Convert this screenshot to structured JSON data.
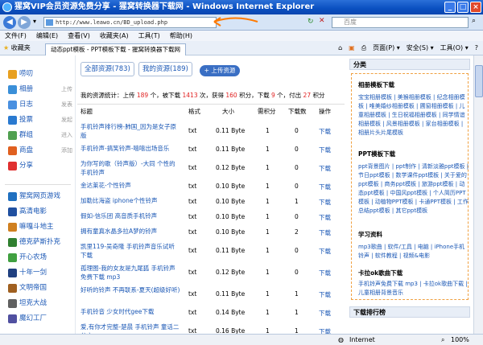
{
  "window": {
    "title": "猩窝VIP会员资源免费分享 - 猩窝转换器下载网 - Windows Internet Explorer",
    "brand_color": "#0a4fc0"
  },
  "address": {
    "url": "http://www.leawo.cn/BD_upload.php"
  },
  "search": {
    "placeholder": "百度"
  },
  "menu": [
    "文件(F)",
    "编辑(E)",
    "查看(V)",
    "收藏夹(A)",
    "工具(T)",
    "帮助(H)"
  ],
  "favbar": {
    "favorites": "收藏夹",
    "tabs": [
      "动态ppt模板 - PPT模板下载 - 猩窝转换器下载网"
    ],
    "tools": [
      "页面(P) ▾",
      "安全(S) ▾",
      "工具(O) ▾",
      "?"
    ]
  },
  "sidebar": {
    "items": [
      {
        "label": "唠叨",
        "sub": "",
        "icon": "chat-icon",
        "color": "#e8a020"
      },
      {
        "label": "相册",
        "sub": "上传",
        "icon": "photo-icon",
        "color": "#3a8fd8"
      },
      {
        "label": "日志",
        "sub": "发表",
        "icon": "log-icon",
        "color": "#4a90e0"
      },
      {
        "label": "投票",
        "sub": "发起",
        "icon": "vote-icon",
        "color": "#2a7ad0"
      },
      {
        "label": "群组",
        "sub": "进入",
        "icon": "group-icon",
        "color": "#50a050"
      },
      {
        "label": "商盘",
        "sub": "添加",
        "icon": "disk-icon",
        "color": "#e06020"
      },
      {
        "label": "分享",
        "sub": "",
        "icon": "heart-icon",
        "color": "#e03030"
      }
    ],
    "apps": [
      {
        "label": "猩窝网页游戏",
        "icon": "game-icon",
        "color": "#2070c0"
      },
      {
        "label": "高清电影",
        "icon": "film-icon",
        "color": "#2050a0"
      },
      {
        "label": "嘛嘎斗地主",
        "icon": "cards-icon",
        "color": "#d08020"
      },
      {
        "label": "德克萨斯扑克",
        "icon": "poker-icon",
        "color": "#308030"
      },
      {
        "label": "开心农场",
        "icon": "farm-icon",
        "color": "#40a040"
      },
      {
        "label": "十年一剑",
        "icon": "sword-icon",
        "color": "#204080"
      },
      {
        "label": "文明帝国",
        "icon": "empire-icon",
        "color": "#a06020"
      },
      {
        "label": "坦克大战",
        "icon": "tank-icon",
        "color": "#606060"
      },
      {
        "label": "魔幻工厂",
        "icon": "factory-icon",
        "color": "#5050a0"
      }
    ]
  },
  "main": {
    "tabs": [
      "全部资源(783)",
      "我的资源(189)"
    ],
    "upload": "+ 上传资源",
    "stats": {
      "prefix": "我的资源统计：上传",
      "upload": "189",
      "u_unit": "个，被下载",
      "downloaded": "1413",
      "d_unit": "次，获得",
      "points": "160",
      "p_unit": "积分，下载",
      "dl": "9",
      "dl_unit": "个，付出",
      "paid": "27",
      "suffix": "积分"
    },
    "headers": [
      "标题",
      "格式",
      "大小",
      "需积分",
      "下载数",
      "操作"
    ],
    "rows": [
      {
        "title": "手机铃声排行榜-肺国_因为是女子原版",
        "fmt": "txt",
        "size": "0.11 Byte",
        "pts": "1",
        "downloads": "0",
        "op": "下载"
      },
      {
        "title": "手机铃声-搞笑铃声-嘻嘻出场音乐",
        "fmt": "txt",
        "size": "0.11 Byte",
        "pts": "1",
        "downloads": "0",
        "op": "下载"
      },
      {
        "title": "为你写的歌（铃声版）-大同 个性的手机铃声",
        "fmt": "txt",
        "size": "0.12 Byte",
        "pts": "1",
        "downloads": "0",
        "op": "下载"
      },
      {
        "title": "金达莱花-个性铃声",
        "fmt": "txt",
        "size": "0.10 Byte",
        "pts": "1",
        "downloads": "0",
        "op": "下载"
      },
      {
        "title": "加勒比海盗 iphone个性铃声",
        "fmt": "txt",
        "size": "0.10 Byte",
        "pts": "1",
        "downloads": "1",
        "op": "下载"
      },
      {
        "title": "假如-信乐团 高音质手机铃声",
        "fmt": "txt",
        "size": "0.10 Byte",
        "pts": "1",
        "downloads": "0",
        "op": "下载"
      },
      {
        "title": "拥有童真水晶多拉A梦的铃声",
        "fmt": "txt",
        "size": "0.10 Byte",
        "pts": "1",
        "downloads": "2",
        "op": "下载"
      },
      {
        "title": "凯里119-吴奇隆 手机铃声音乐试听下载",
        "fmt": "txt",
        "size": "0.11 Byte",
        "pts": "1",
        "downloads": "0",
        "op": "下载"
      },
      {
        "title": "孤理图-我的女友是九尾狐 手机铃声免费下载 mp3",
        "fmt": "txt",
        "size": "0.12 Byte",
        "pts": "1",
        "downloads": "0",
        "op": "下载"
      },
      {
        "title": "好听的铃声 不再联系-夏天(超级好听)",
        "fmt": "txt",
        "size": "0.11 Byte",
        "pts": "1",
        "downloads": "1",
        "op": "下载"
      },
      {
        "title": "手机铃音 少女时代gee下载",
        "fmt": "txt",
        "size": "0.14 Byte",
        "pts": "1",
        "downloads": "1",
        "op": "下载"
      },
      {
        "title": "爱,有你才完整-楚晨 手机铃声 童话二分之一",
        "fmt": "txt",
        "size": "0.16 Byte",
        "pts": "1",
        "downloads": "1",
        "op": "下载"
      }
    ]
  },
  "right": {
    "header": "分类",
    "sections": [
      {
        "title": "相册模板下载",
        "text": "宝宝相册模板 | 美猴相册模板 | 纪念相册模板 | 唯美婚纱相册模板 | 圃窗相册模板 | 儿童相册模板 | 生日祝福相册模板 | 同学情谊相册模板 | 风景相册模板 | 家台相册模板 | 相册片头片尾模板"
      },
      {
        "title": "PPT模板下载",
        "text": "ppt背景图片 | ppt制作 | 清新淡雅ppt模板 | 节日ppt模板 | 数学课件ppt模板 | 关于爱的ppt模板 | 商务ppt模板 | 旅游ppt模板 | 动态ppt模板 | 中国风ppt模板 | 个人简历PPT模板 | 动植物PPT模板 | 卡通PPT模板 | 工作总结ppt模板 | 其它ppt模板"
      },
      {
        "title": "学习资料",
        "text": "mp3歌曲 | 软件/工具 | 电脑 | iPhone手机铃声 | 软件教程 | 视频&电影"
      },
      {
        "title": "卡拉ok歌曲下载",
        "text": "手机铃声免费下载 mp3 | 卡拉ok歌曲下载 | 儿童相册背景音乐"
      }
    ],
    "bottom_header": "下载排行榜"
  },
  "status": {
    "zone": "Internet",
    "zoom": "100%"
  }
}
